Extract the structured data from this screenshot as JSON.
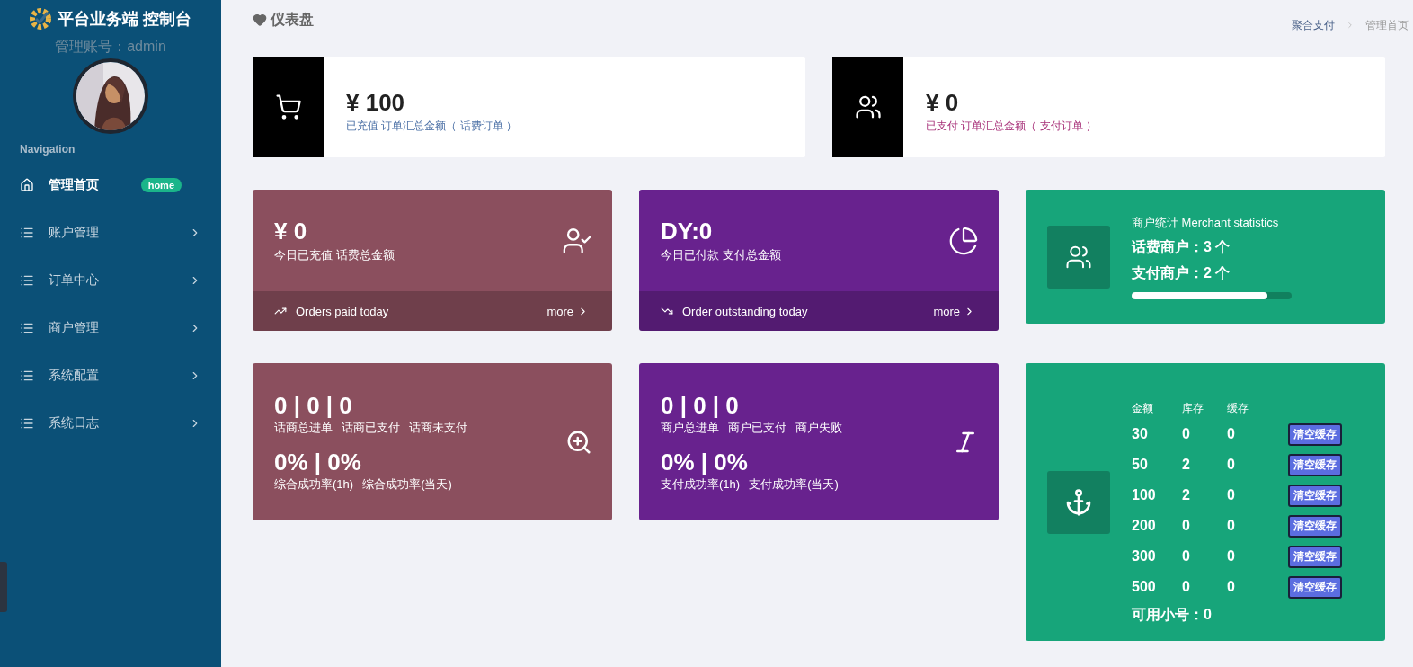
{
  "sidebar": {
    "brand": "平台业务端 控制台",
    "account": "管理账号：admin",
    "section_label": "Navigation",
    "items": [
      {
        "label": "管理首页",
        "kind": "home",
        "badge": "home",
        "has_submenu": false,
        "selected": true
      },
      {
        "label": "账户管理",
        "kind": "menu",
        "has_submenu": true,
        "selected": false
      },
      {
        "label": "订单中心",
        "kind": "menu",
        "has_submenu": true,
        "selected": false
      },
      {
        "label": "商户管理",
        "kind": "menu",
        "has_submenu": true,
        "selected": false
      },
      {
        "label": "系统配置",
        "kind": "menu",
        "has_submenu": true,
        "selected": false
      },
      {
        "label": "系统日志",
        "kind": "menu",
        "has_submenu": true,
        "selected": false
      }
    ]
  },
  "page_title": "仪表盘",
  "breadcrumb": [
    {
      "label": "聚合支付",
      "selected": false
    },
    {
      "label": "管理首页",
      "selected": true
    }
  ],
  "summary_cards": [
    {
      "amount": "¥ 100",
      "caption": "已充值 订单汇总金额（ 话费订单 ）",
      "color": "#4a6fa5"
    },
    {
      "amount": "¥ 0",
      "caption": "已支付 订单汇总金额（ 支付订单 ）",
      "color": "#a8327a"
    }
  ],
  "daily_cards": [
    {
      "value": "¥ 0",
      "caption": "今日已充值 话费总金额",
      "color": "#8b4f5e",
      "footer": "Orders paid today",
      "more": "more"
    },
    {
      "value": "DY:0",
      "caption": "今日已付款 支付总金额",
      "color": "#68228e",
      "footer": "Order outstanding today",
      "more": "more"
    }
  ],
  "merchant_stats": {
    "title": "商户统计 Merchant statistics",
    "lines": [
      "话费商户：3 个",
      "支付商户：2 个"
    ],
    "level": 0.85
  },
  "count_cards": [
    {
      "counts": "0 | 0 | 0",
      "labels": [
        "话商总进单",
        "话商已支付",
        "话商未支付"
      ],
      "rates": "0% | 0%",
      "rate_labels": [
        "综合成功率(1h)",
        "综合成功率(当天)"
      ],
      "color": "#8b4f5e"
    },
    {
      "counts": "0 | 0 | 0",
      "labels": [
        "商户总进单",
        "商户已支付",
        "商户失败"
      ],
      "rates": "0% | 0%",
      "rate_labels": [
        "支付成功率(1h)",
        "支付成功率(当天)"
      ],
      "color": "#68228e"
    }
  ],
  "stock_table": {
    "columns": [
      "金额",
      "库存",
      "缓存"
    ],
    "rows": [
      {
        "cells": [
          "30",
          "0",
          "0"
        ],
        "action": "清空缓存"
      },
      {
        "cells": [
          "50",
          "2",
          "0"
        ],
        "action": "清空缓存"
      },
      {
        "cells": [
          "100",
          "2",
          "0"
        ],
        "action": "清空缓存"
      },
      {
        "cells": [
          "200",
          "0",
          "0"
        ],
        "action": "清空缓存"
      },
      {
        "cells": [
          "300",
          "0",
          "0"
        ],
        "action": "清空缓存"
      },
      {
        "cells": [
          "500",
          "0",
          "0"
        ],
        "action": "清空缓存"
      }
    ],
    "footer": "可用小号：0"
  }
}
